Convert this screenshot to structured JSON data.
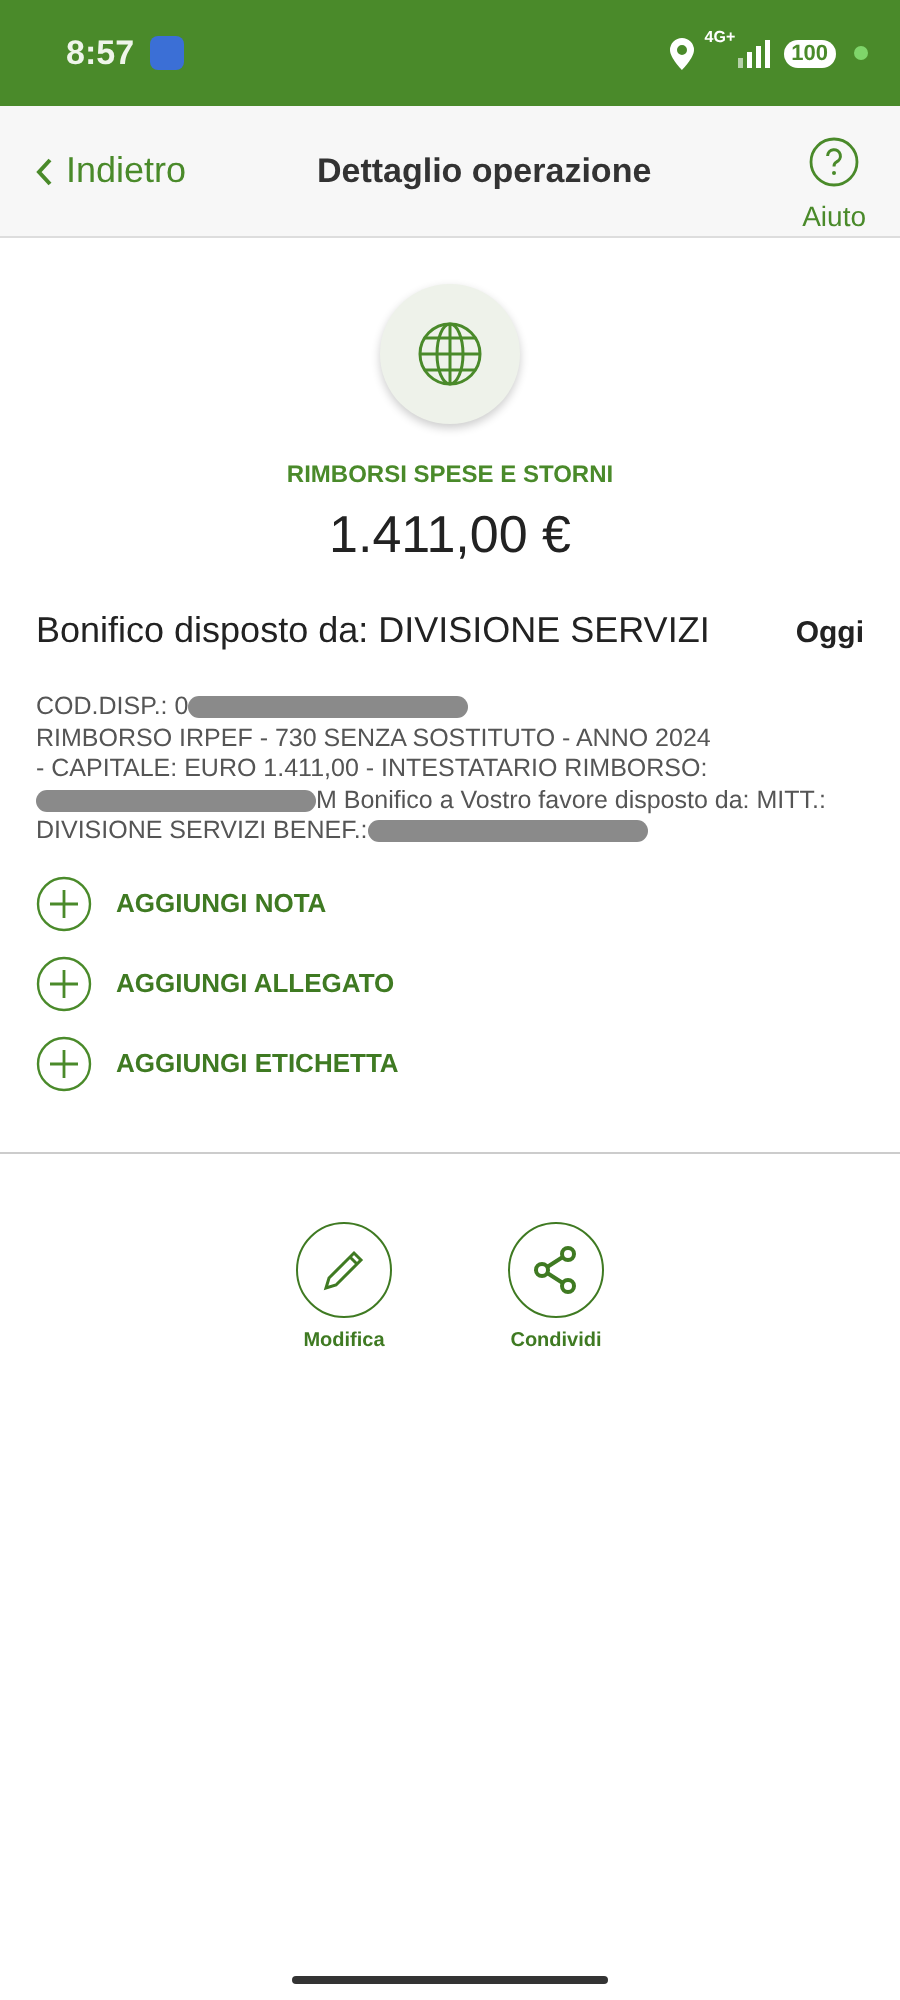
{
  "status_bar": {
    "time": "8:57",
    "network": "4G+",
    "battery": "100"
  },
  "header": {
    "back": "Indietro",
    "title": "Dettaglio operazione",
    "help": "Aiuto"
  },
  "operation": {
    "category": "RIMBORSI SPESE E STORNI",
    "amount": "1.411,00 €",
    "title": "Bonifico disposto da: DIVISIONE SERVIZI",
    "date": "Oggi",
    "description": [
      [
        {
          "kind": "text",
          "text": "COD.DISP.: 0"
        },
        {
          "kind": "redacted"
        }
      ],
      [
        {
          "kind": "text",
          "text": "RIMBORSO IRPEF - 730 SENZA SOSTITUTO - ANNO 2024"
        }
      ],
      [
        {
          "kind": "text",
          "text": "- CAPITALE: EURO 1.411,00 - INTESTATARIO RIMBORSO:"
        }
      ],
      [
        {
          "kind": "redacted"
        },
        {
          "kind": "text",
          "text": "M Bonifico a Vostro favore disposto da: MITT.:"
        }
      ],
      [
        {
          "kind": "text",
          "text": "DIVISIONE SERVIZI BENEF.:"
        },
        {
          "kind": "redacted"
        }
      ]
    ]
  },
  "actions": [
    "AGGIUNGI NOTA",
    "AGGIUNGI ALLEGATO",
    "AGGIUNGI ETICHETTA"
  ],
  "buttons": [
    {
      "kind": "edit",
      "label": "Modifica"
    },
    {
      "kind": "share",
      "label": "Condividi"
    }
  ]
}
